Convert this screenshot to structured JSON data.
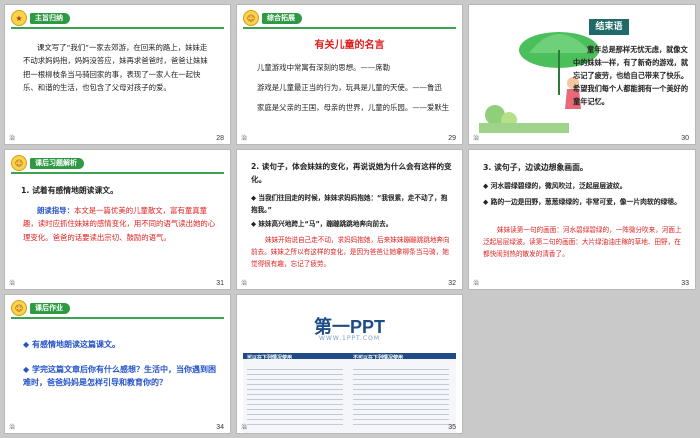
{
  "slides": [
    {
      "num": "28",
      "mark": "治",
      "heading": "主旨归纳",
      "text": "课文写了“我们”一家去郊游，在回来的路上，妹妹走不动求妈妈抱，妈妈没答应，妹再求爸爸时，爸爸让妹妹把一根柳枝条当马骑回家的事，表现了一家人在一起快乐、和谐的生活，也包含了父母对孩子的爱。"
    },
    {
      "num": "29",
      "mark": "治",
      "heading": "综合拓展",
      "title": "有关儿童的名言",
      "lines": [
        "儿童游戏中常寓有深刻的思想。——席勒",
        "游戏是儿童最正当的行为，玩具是儿童的天使。——鲁迅",
        "家庭是父亲的王国，母亲的世界，儿童的乐园。——爱默生"
      ]
    },
    {
      "num": "30",
      "mark": "治",
      "heading": "结束语",
      "text": "童年总是那样无忧无虑，就像文中的妹妹一样，有了新奇的游戏，就忘记了疲劳，也给自己带来了快乐。希望我们每个人都能拥有一个美好的童年记忆。"
    },
    {
      "num": "31",
      "mark": "治",
      "heading": "课后习题解析",
      "q": "1. 试着有感情地朗读课文。",
      "guide_label": "朗读指导：",
      "guide": "本文是一篇优美的儿童散文，富有童真童趣，读时应抓住妹妹的感情变化，用不同的语气读出她的心理变化。爸爸的话要读出宗切、鼓励的语气。"
    },
    {
      "num": "32",
      "mark": "治",
      "q": "2. 读句子，体会妹妹的变化，再说说她为什么会有这样的变化。",
      "b1": "当我们往回走的时候，妹妹求妈妈抱她：“我很累，走不动了，抱抱我。”",
      "b2": "妹妹高兴地跨上“马”，蹦蹦跳跳地奔向前去。",
      "ans": "妹妹开始说自己走不动，求妈妈抱她，后来妹妹蹦蹦跳跳地奔向前去。妹妹之所以有这样的变化，是因为爸爸让她拿柳条当马骑，她觉得很有趣，忘记了疲劳。"
    },
    {
      "num": "33",
      "mark": "治",
      "q": "3. 读句子，边读边想象画面。",
      "b1": "河水碧绿碧绿的，微风吹过，泛起层层波纹。",
      "b2": "路的一边是田野，葱葱绿绿的，非常可爱，像一片肉软的绿毯。",
      "ans": "妹妹读第一句的画面：河水碧绿碧绿的，一阵微分吹来，河面上泛起层层绿波。读第二句的画面：大片绿油油庄稼的草地、田野，在都快闹到热的散发的清香了。"
    },
    {
      "num": "34",
      "mark": "治",
      "heading": "课后作业",
      "items": [
        "有感情地朗读这篇课文。",
        "学完这篇文章后你有什么感想？生活中，当你遇到困难时，爸爸妈妈是怎样引导和教育你的？"
      ]
    },
    {
      "num": "35",
      "mark": "治",
      "brand": "第一PPT",
      "url": "WWW.1PPT.COM",
      "left_head": "可以在下列情况使用",
      "right_head": "不可以在下列情况使用"
    }
  ]
}
